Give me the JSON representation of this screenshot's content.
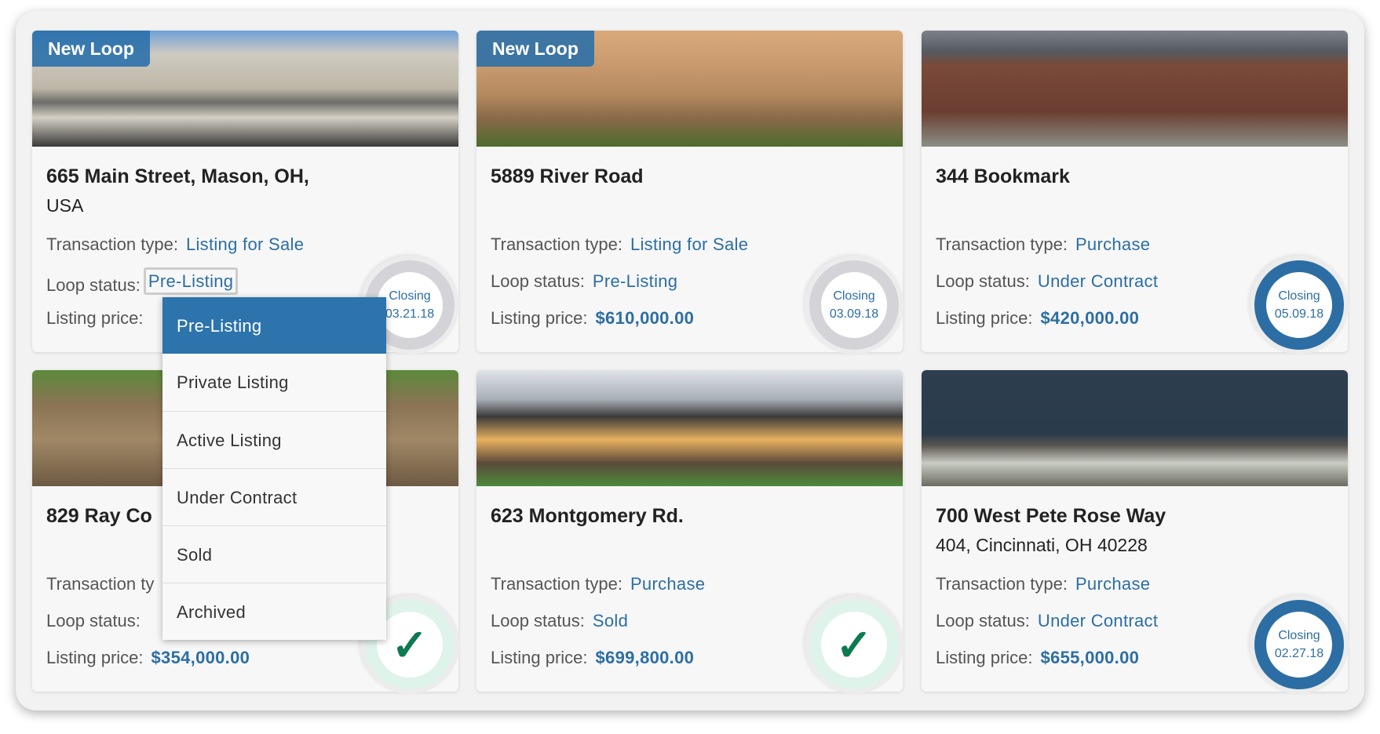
{
  "labels": {
    "transaction_type": "Transaction type:",
    "loop_status": "Loop status:",
    "listing_price": "Listing price:",
    "closing": "Closing"
  },
  "cards": [
    {
      "badge": "New Loop",
      "title": "665 Main Street, Mason, OH,",
      "title2": "USA",
      "transaction_type": "Listing for Sale",
      "loop_status": "Pre-Listing",
      "listing_price": "",
      "closing_date": "03.21.18",
      "state": "gray"
    },
    {
      "badge": "New Loop",
      "title": "5889 River Road",
      "title2": "",
      "transaction_type": "Listing for Sale",
      "loop_status": "Pre-Listing",
      "listing_price": "$610,000.00",
      "closing_date": "03.09.18",
      "state": "gray"
    },
    {
      "badge": "",
      "title": "344 Bookmark",
      "title2": "",
      "transaction_type": "Purchase",
      "loop_status": "Under Contract",
      "listing_price": "$420,000.00",
      "closing_date": "05.09.18",
      "state": "blue"
    },
    {
      "badge": "",
      "title": "829 Ray Co",
      "title2": "",
      "transaction_type": "",
      "loop_status": "",
      "listing_price": "$354,000.00",
      "closing_date": "",
      "state": "done",
      "transaction_label": "Transaction ty"
    },
    {
      "badge": "",
      "title": "623 Montgomery Rd.",
      "title2": "",
      "transaction_type": "Purchase",
      "loop_status": "Sold",
      "listing_price": "$699,800.00",
      "closing_date": "",
      "state": "done"
    },
    {
      "badge": "",
      "title": "700 West Pete Rose Way",
      "title2": "404, Cincinnati, OH 40228",
      "transaction_type": "Purchase",
      "loop_status": "Under Contract",
      "listing_price": "$655,000.00",
      "closing_date": "02.27.18",
      "state": "blue"
    }
  ],
  "dropdown": {
    "options": [
      "Pre-Listing",
      "Private Listing",
      "Active Listing",
      "Under Contract",
      "Sold",
      "Archived"
    ],
    "selected": "Pre-Listing"
  },
  "icons": {
    "check": "✓",
    "check_name": "checkmark-icon"
  },
  "colors": {
    "accent": "#2c6ea4",
    "success": "#0d7a4f"
  }
}
